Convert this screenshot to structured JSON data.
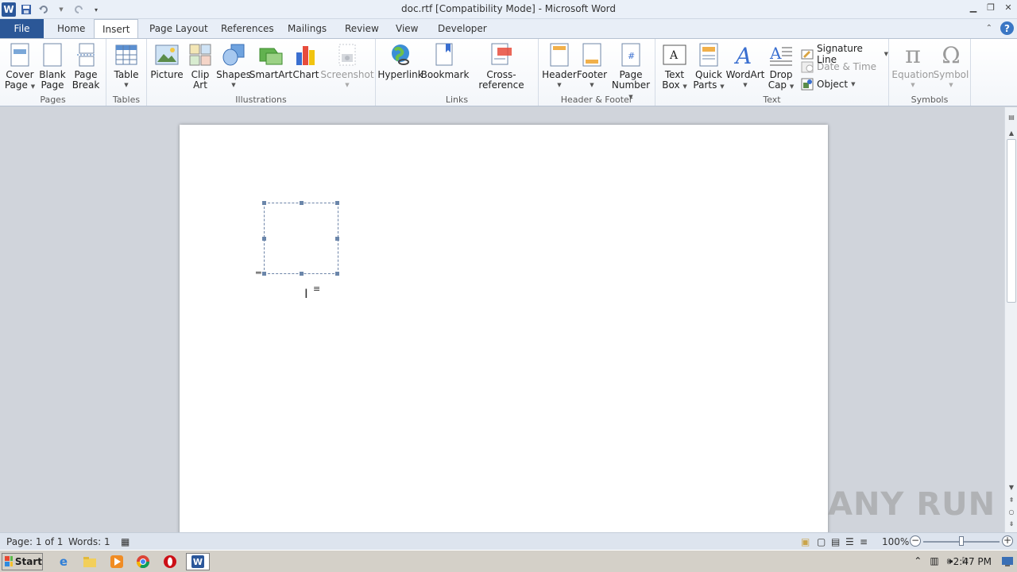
{
  "window": {
    "title": "doc.rtf [Compatibility Mode]  -  Microsoft Word",
    "app_icon_letter": "W"
  },
  "tabs": {
    "file": "File",
    "home": "Home",
    "insert": "Insert",
    "page_layout": "Page Layout",
    "references": "References",
    "mailings": "Mailings",
    "review": "Review",
    "view": "View",
    "developer": "Developer",
    "help": "?"
  },
  "ribbon": {
    "pages": {
      "label": "Pages",
      "cover_page_1": "Cover",
      "cover_page_2": "Page",
      "blank_page_1": "Blank",
      "blank_page_2": "Page",
      "page_break_1": "Page",
      "page_break_2": "Break"
    },
    "tables": {
      "label": "Tables",
      "table": "Table"
    },
    "illustrations": {
      "label": "Illustrations",
      "picture": "Picture",
      "clip_art_1": "Clip",
      "clip_art_2": "Art",
      "shapes": "Shapes",
      "smartart": "SmartArt",
      "chart": "Chart",
      "screenshot": "Screenshot"
    },
    "links": {
      "label": "Links",
      "hyperlink": "Hyperlink",
      "bookmark": "Bookmark",
      "cross_reference": "Cross-reference"
    },
    "header_footer": {
      "label": "Header & Footer",
      "header": "Header",
      "footer": "Footer",
      "page_number_1": "Page",
      "page_number_2": "Number"
    },
    "text": {
      "label": "Text",
      "text_box_1": "Text",
      "text_box_2": "Box",
      "quick_parts_1": "Quick",
      "quick_parts_2": "Parts",
      "wordart": "WordArt",
      "drop_cap_1": "Drop",
      "drop_cap_2": "Cap",
      "signature_line": "Signature Line",
      "date_time": "Date & Time",
      "object": "Object"
    },
    "symbols": {
      "label": "Symbols",
      "equation": "Equation",
      "symbol": "Symbol"
    }
  },
  "status": {
    "page": "Page: 1 of 1",
    "words": "Words: 1",
    "zoom": "100%",
    "zoom_level_percent": 100
  },
  "watermark": "ANY RUN",
  "taskbar": {
    "start": "Start",
    "clock": "2:47 PM"
  }
}
